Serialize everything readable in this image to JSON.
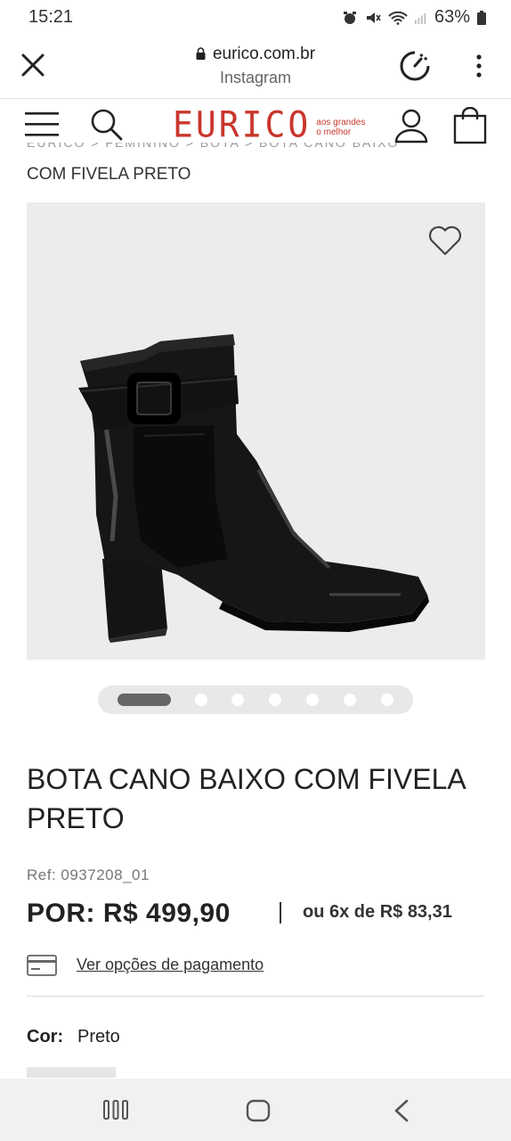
{
  "status_bar": {
    "time": "15:21",
    "battery": "63%",
    "icons": [
      "alarm-icon",
      "mute-icon",
      "wifi-icon",
      "signal-icon",
      "battery-icon"
    ]
  },
  "browser": {
    "domain": "eurico.com.br",
    "source": "Instagram",
    "icons": [
      "close-icon",
      "lock-icon",
      "speed-icon",
      "more-icon"
    ]
  },
  "header": {
    "logo_text": "EURICO",
    "tagline_line1": "aos grandes",
    "tagline_line2": "o melhor",
    "brand_color": "#c9362b",
    "icons": [
      "menu-icon",
      "search-icon",
      "user-icon",
      "bag-icon"
    ]
  },
  "breadcrumb": {
    "cut_text": "EURICO  >  FEMININO  >  BOTA  >  BOTA CANO BAIXO",
    "current": "COM FIVELA PRETO"
  },
  "gallery": {
    "image_alt": "black ankle boot with buckle",
    "active_index": 0,
    "total": 7
  },
  "product": {
    "title": "BOTA CANO BAIXO COM FIVELA PRETO",
    "ref": "Ref: 0937208_01",
    "price": "POR: R$ 499,90",
    "installments": "ou 6x de R$ 83,31",
    "payment_link": "Ver opções de pagamento",
    "color_label": "Cor:",
    "color_value": "Preto"
  },
  "navbar": {
    "icons": [
      "recents-icon",
      "home-icon",
      "back-icon"
    ]
  }
}
